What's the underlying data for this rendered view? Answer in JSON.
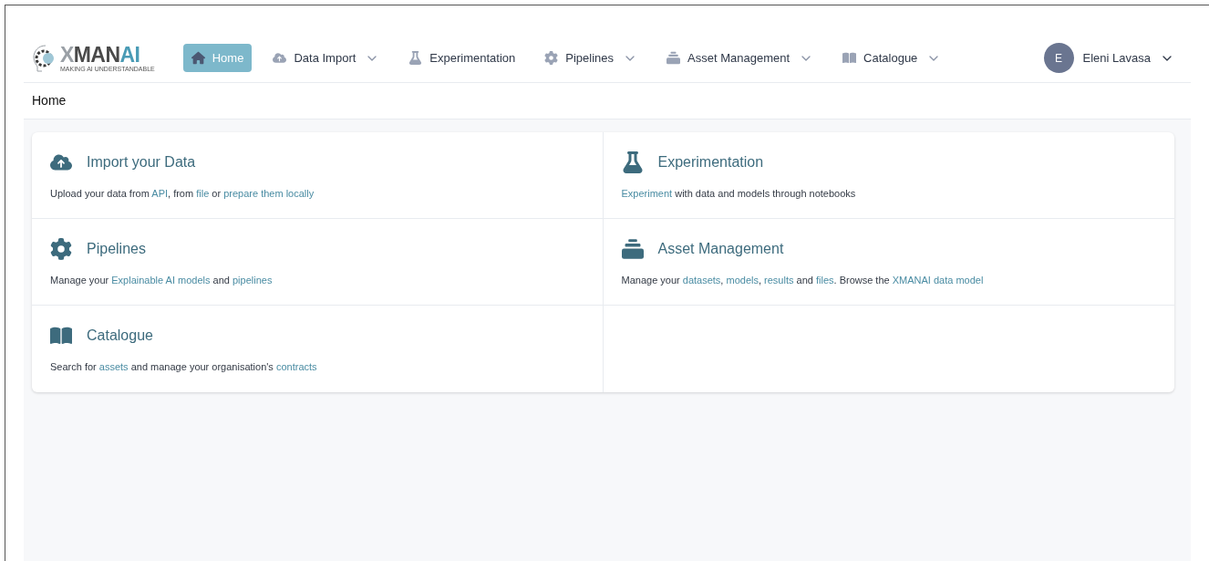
{
  "logo": {
    "parts": [
      "X",
      "MAN",
      "AI"
    ],
    "tagline": "MAKING AI UNDERSTANDABLE"
  },
  "nav": [
    {
      "label": "Home",
      "kind": "home",
      "dropdown": false,
      "selected": true
    },
    {
      "label": "Data Import",
      "kind": "upload",
      "dropdown": true,
      "selected": false
    },
    {
      "label": "Experimentation",
      "kind": "flask",
      "dropdown": false,
      "selected": false
    },
    {
      "label": "Pipelines",
      "kind": "gear",
      "dropdown": true,
      "selected": false
    },
    {
      "label": "Asset Management",
      "kind": "stack",
      "dropdown": true,
      "selected": false
    },
    {
      "label": "Catalogue",
      "kind": "book",
      "dropdown": true,
      "selected": false
    }
  ],
  "user": {
    "initial": "E",
    "name": "Eleni Lavasa"
  },
  "breadcrumb": "Home",
  "cards": [
    {
      "kind": "upload",
      "title": "Import your Data",
      "description": [
        {
          "kind": "text",
          "text": "Upload your data from "
        },
        {
          "kind": "link",
          "text": "API"
        },
        {
          "kind": "text",
          "text": ", from "
        },
        {
          "kind": "link",
          "text": "file"
        },
        {
          "kind": "text",
          "text": " or "
        },
        {
          "kind": "link",
          "text": "prepare them locally"
        }
      ]
    },
    {
      "kind": "flask",
      "title": "Experimentation",
      "description": [
        {
          "kind": "link",
          "text": "Experiment"
        },
        {
          "kind": "text",
          "text": " with data and models through notebooks"
        }
      ]
    },
    {
      "kind": "gear",
      "title": "Pipelines",
      "description": [
        {
          "kind": "text",
          "text": "Manage your "
        },
        {
          "kind": "link",
          "text": "Explainable AI models"
        },
        {
          "kind": "text",
          "text": " and "
        },
        {
          "kind": "link",
          "text": "pipelines"
        }
      ]
    },
    {
      "kind": "stack",
      "title": "Asset Management",
      "description": [
        {
          "kind": "text",
          "text": "Manage your "
        },
        {
          "kind": "link",
          "text": "datasets"
        },
        {
          "kind": "text",
          "text": ", "
        },
        {
          "kind": "link",
          "text": "models"
        },
        {
          "kind": "text",
          "text": ", "
        },
        {
          "kind": "link",
          "text": "results"
        },
        {
          "kind": "text",
          "text": " and "
        },
        {
          "kind": "link",
          "text": "files"
        },
        {
          "kind": "text",
          "text": ". Browse the "
        },
        {
          "kind": "link",
          "text": "XMANAI data model"
        }
      ]
    },
    {
      "kind": "book",
      "title": "Catalogue",
      "description": [
        {
          "kind": "text",
          "text": "Search for "
        },
        {
          "kind": "link",
          "text": "assets"
        },
        {
          "kind": "text",
          "text": " and manage your organisation's "
        },
        {
          "kind": "link",
          "text": "contracts"
        }
      ]
    }
  ]
}
